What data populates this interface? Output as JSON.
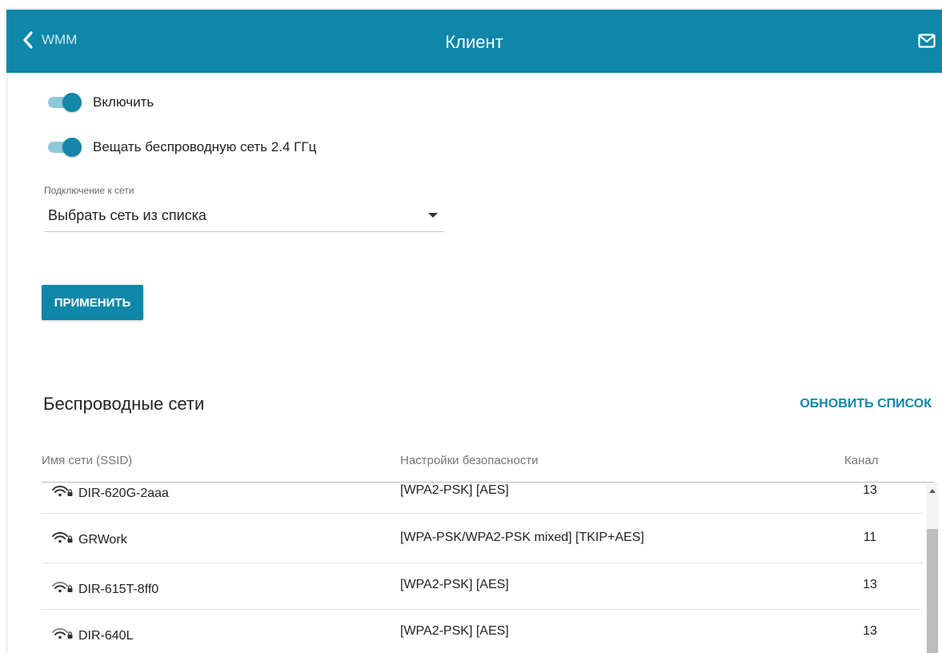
{
  "header": {
    "back_label": "WMM",
    "title": "Клиент"
  },
  "settings": {
    "enable_label": "Включить",
    "enable_on": true,
    "broadcast_label": "Вещать беспроводную сеть 2.4 ГГц",
    "broadcast_on": true,
    "connection_label": "Подключение к сети",
    "connection_value": "Выбрать сеть из списка"
  },
  "apply_label": "ПРИМЕНИТЬ",
  "networks": {
    "title": "Беспроводные сети",
    "refresh_label": "ОБНОВИТЬ СПИСОК",
    "columns": {
      "ssid": "Имя сети (SSID)",
      "security": "Настройки безопасности",
      "channel": "Канал"
    },
    "rows": [
      {
        "ssid": "DIR-620G-2aaa",
        "security": "[WPA2-PSK] [AES]",
        "channel": "13"
      },
      {
        "ssid": "GRWork",
        "security": "[WPA-PSK/WPA2-PSK mixed] [TKIP+AES]",
        "channel": "11"
      },
      {
        "ssid": "DIR-615T-8ff0",
        "security": "[WPA2-PSK] [AES]",
        "channel": "13"
      },
      {
        "ssid": "DIR-640L",
        "security": "[WPA2-PSK] [AES]",
        "channel": "13"
      }
    ]
  },
  "icons": {
    "back": "chevron-left-icon",
    "mail": "mail-icon",
    "wifi": "wifi-lock-icon"
  },
  "colors": {
    "accent": "#0e87a9",
    "toggle_track": "#8ec9da"
  }
}
